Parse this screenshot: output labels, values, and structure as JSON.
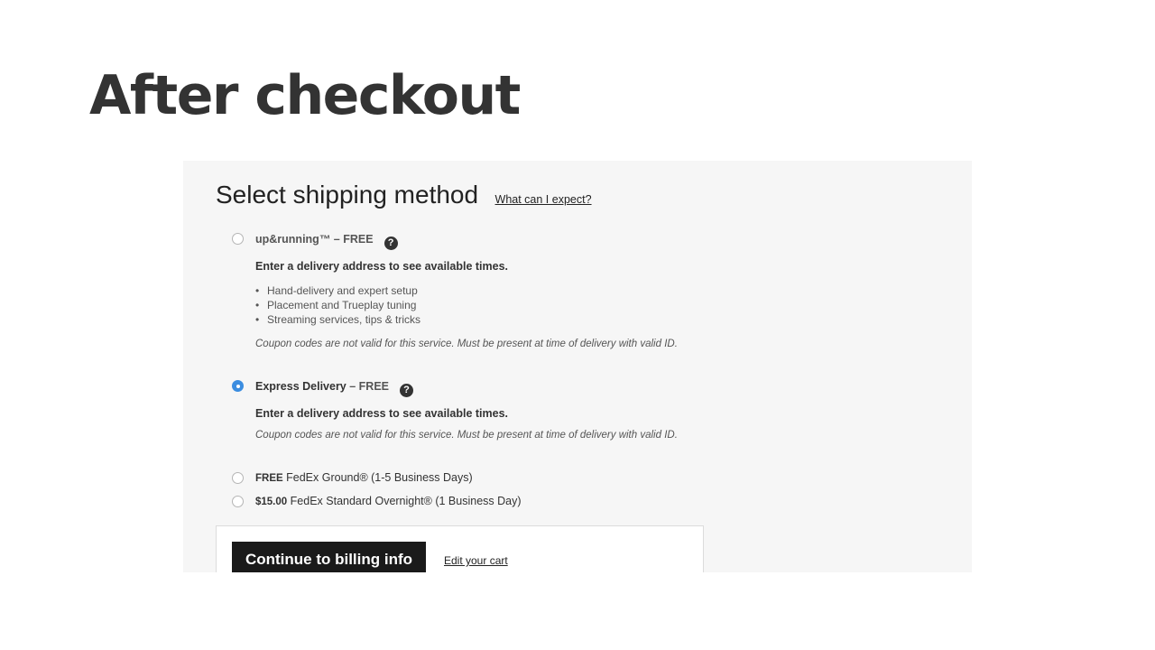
{
  "slide": {
    "title": "After checkout"
  },
  "shipping": {
    "title": "Select shipping method",
    "help_link": "What can I expect?",
    "options": [
      {
        "name": "up&running™",
        "price": " – FREE",
        "selected": false,
        "notice": "Enter a delivery address to see available times.",
        "features": [
          "Hand-delivery and expert setup",
          "Placement and Trueplay tuning",
          "Streaming services, tips & tricks"
        ],
        "coupon_note": "Coupon codes are not valid for this service. Must be present at time of delivery with valid ID."
      },
      {
        "name": "Express Delivery",
        "price": " – FREE",
        "selected": true,
        "notice": "Enter a delivery address to see available times.",
        "coupon_note": "Coupon codes are not valid for this service. Must be present at time of delivery with valid ID."
      },
      {
        "price": "FREE",
        "name": " FedEx Ground® (1-5 Business Days)",
        "selected": false
      },
      {
        "price": "$15.00",
        "name": " FedEx Standard Overnight® (1 Business Day)",
        "selected": false
      }
    ],
    "help_icon_glyph": "?",
    "help_icon": "question-circle-icon"
  },
  "actions": {
    "continue_label": "Continue to billing info",
    "edit_cart_label": "Edit your cart"
  },
  "colors": {
    "selected_radio": "#3b8de0",
    "primary_button": "#1a1a1a",
    "panel_bg": "#f6f6f6"
  }
}
